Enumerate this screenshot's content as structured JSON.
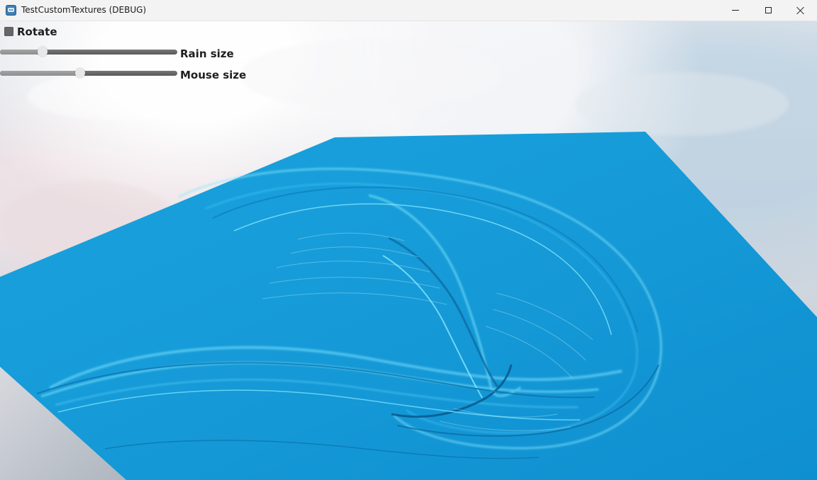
{
  "window": {
    "title": "TestCustomTextures (DEBUG)",
    "icon": "godot-app-icon"
  },
  "window_controls": {
    "minimize": "minimize-icon",
    "maximize": "maximize-icon",
    "close": "close-icon"
  },
  "controls": {
    "rotate": {
      "label": "Rotate",
      "checked": false
    },
    "sliders": [
      {
        "label": "Rain size",
        "value": 0.24
      },
      {
        "label": "Mouse size",
        "value": 0.45
      }
    ]
  },
  "scene": {
    "background": "cloudy sky",
    "water_color": "#169bd8",
    "highlight_color": "#8fe6ff",
    "shadow_color": "#0b73ad"
  }
}
